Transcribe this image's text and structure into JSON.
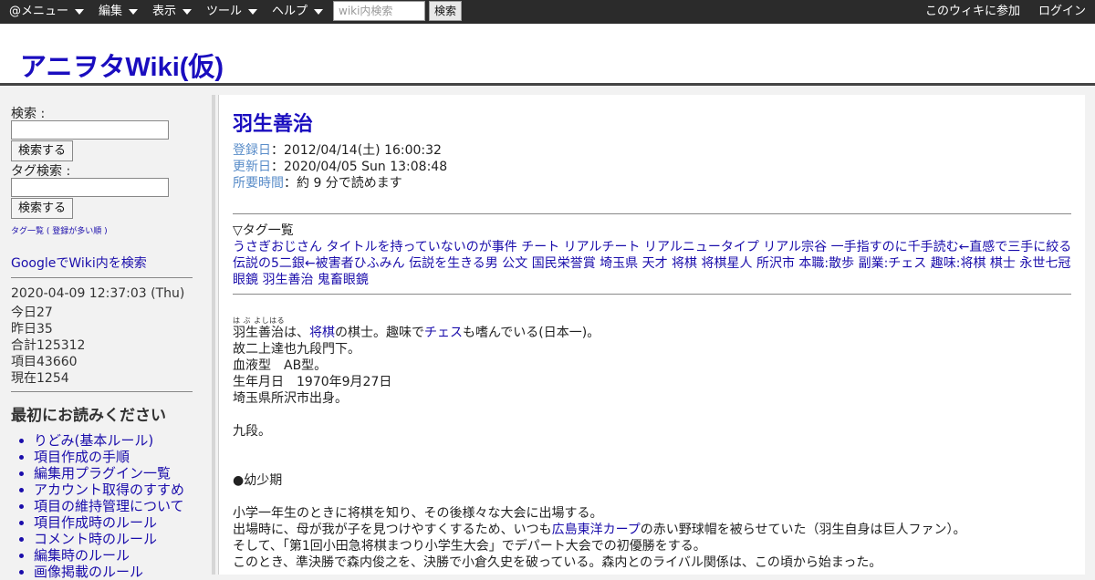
{
  "topbar": {
    "menus": [
      "@メニュー",
      "編集",
      "表示",
      "ツール",
      "ヘルプ"
    ],
    "search_placeholder": "wiki内検索",
    "search_button": "検索",
    "join_link": "このウィキに参加",
    "login_link": "ログイン"
  },
  "header": {
    "site_title": "アニヲタWiki(仮)"
  },
  "sidebar": {
    "search_label": "検索 :",
    "search_button": "検索する",
    "tag_search_label": "タグ検索 :",
    "tag_search_button": "検索する",
    "tag_list_link": "タグ一覧 ( 登録が多い順 )",
    "google_search_link": "GoogleでWiki内を検索",
    "stats": {
      "datetime": "2020-04-09 12:37:03 (Thu)",
      "today": "今日27",
      "yesterday": "昨日35",
      "total": "合計125312",
      "items": "項目43660",
      "now": "現在1254"
    },
    "read_first_title": "最初にお読みください",
    "read_first_items": [
      "りどみ(基本ルール)",
      "項目作成の手順",
      "編集用プラグイン一覧",
      "アカウント取得のすすめ",
      "項目の維持管理について",
      "項目作成時のルール",
      "コメント時のルール",
      "編集時のルール",
      "画像掲載のルール"
    ]
  },
  "article": {
    "title": "羽生善治",
    "registered_label": "登録日",
    "registered_value": "：2012/04/14(土) 16:00:32",
    "updated_label": "更新日",
    "updated_value": "：2020/04/05 Sun 13:08:48",
    "reading_time_label": "所要時間",
    "reading_time_value": "：約 9 分で読めます",
    "tag_heading": "▽タグ一覧",
    "tags_line1": "うさぎおじさん タイトルを持っていないのが事件 チート リアルチート リアルニュータイプ リアル宗谷 一手指すのに千手読む←直感で三手に絞る",
    "tags_line2": "伝説の5二銀←被害者ひふみん 伝説を生きる男 公文 国民栄誉賞 埼玉県 天才 将棋 将棋星人 所沢市 本職:散歩 副業:チェス 趣味:将棋 棋士 永世七冠",
    "tags_line3": "眼鏡 羽生善治 鬼畜眼鏡",
    "ruby": "は ぶ よしはる",
    "intro_1": "羽生善治は、",
    "intro_link1": "将棋",
    "intro_2": "の棋士。趣味で",
    "intro_link2": "チェス",
    "intro_3": "も嗜んでいる(日本一)。",
    "lines": [
      "故二上達也九段門下。",
      "血液型　AB型。",
      "生年月日　1970年9月27日",
      "埼玉県所沢市出身。",
      "九段。",
      "●幼少期",
      "小学一年生のときに将棋を知り、その後様々な大会に出場する。"
    ],
    "line_cap_1": "出場時に、母が我が子を見つけやすくするため、いつも",
    "line_cap_link": "広島東洋カープ",
    "line_cap_2": "の赤い野球帽を被らせていた（羽生自身は巨人ファン）。",
    "line_tourney": "そして、「第1回小田急将棋まつり小学生大会」でデパート大会での初優勝をする。",
    "line_rival": "このとき、準決勝で森内俊之を、決勝で小倉久史を破っている。森内とのライバル関係は、この頃から始まった。"
  }
}
